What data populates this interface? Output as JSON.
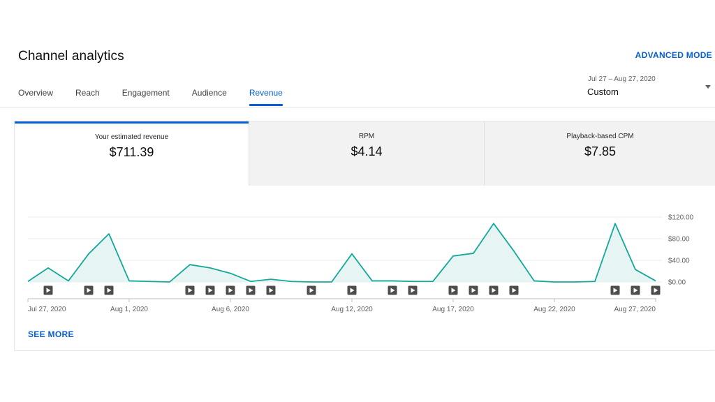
{
  "page": {
    "title": "Channel analytics",
    "advanced_mode": "ADVANCED MODE"
  },
  "tabs": [
    {
      "label": "Overview"
    },
    {
      "label": "Reach"
    },
    {
      "label": "Engagement"
    },
    {
      "label": "Audience"
    },
    {
      "label": "Revenue",
      "active": true
    }
  ],
  "date_picker": {
    "range": "Jul 27 – Aug 27, 2020",
    "value": "Custom"
  },
  "metrics": [
    {
      "label": "Your estimated revenue",
      "value": "$711.39",
      "selected": true
    },
    {
      "label": "RPM",
      "value": "$4.14"
    },
    {
      "label": "Playback-based CPM",
      "value": "$7.85"
    }
  ],
  "see_more": "SEE MORE",
  "colors": {
    "accent": "#065fd4",
    "line": "#14a89a",
    "fill": "#e6f5f3"
  },
  "chart_data": {
    "type": "area",
    "x": [
      "Jul 27",
      "Jul 28",
      "Jul 29",
      "Jul 30",
      "Jul 31",
      "Aug 1",
      "Aug 2",
      "Aug 3",
      "Aug 4",
      "Aug 5",
      "Aug 6",
      "Aug 7",
      "Aug 8",
      "Aug 9",
      "Aug 10",
      "Aug 11",
      "Aug 12",
      "Aug 13",
      "Aug 14",
      "Aug 15",
      "Aug 16",
      "Aug 17",
      "Aug 18",
      "Aug 19",
      "Aug 20",
      "Aug 21",
      "Aug 22",
      "Aug 23",
      "Aug 24",
      "Aug 25",
      "Aug 26",
      "Aug 27"
    ],
    "series": [
      {
        "values": [
          1,
          26,
          2,
          52,
          89,
          2,
          1,
          0,
          32,
          26,
          16,
          1,
          5,
          1,
          0,
          0,
          52,
          2,
          2,
          1,
          1,
          48,
          53,
          108,
          57,
          2,
          0,
          0,
          1,
          108,
          23,
          2
        ]
      }
    ],
    "x_tick_labels": [
      {
        "index": 0,
        "label": "Jul 27, 2020"
      },
      {
        "index": 5,
        "label": "Aug 1, 2020"
      },
      {
        "index": 10,
        "label": "Aug 6, 2020"
      },
      {
        "index": 16,
        "label": "Aug 12, 2020"
      },
      {
        "index": 21,
        "label": "Aug 17, 2020"
      },
      {
        "index": 26,
        "label": "Aug 22, 2020"
      },
      {
        "index": 31,
        "label": "Aug 27, 2020"
      }
    ],
    "y_ticks": [
      0,
      40,
      80,
      120
    ],
    "y_tick_labels": [
      "$0.00",
      "$40.00",
      "$80.00",
      "$120.00"
    ],
    "ylim": [
      0,
      120
    ],
    "y_axis_side": "right",
    "grid": true,
    "video_marker_indices": [
      1,
      3,
      4,
      8,
      9,
      10,
      11,
      12,
      14,
      16,
      18,
      19,
      21,
      22,
      23,
      24,
      29,
      30,
      31
    ]
  }
}
